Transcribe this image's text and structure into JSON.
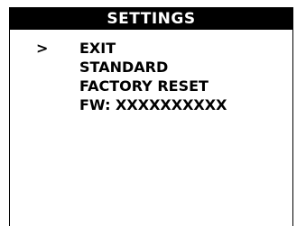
{
  "title": "SETTINGS",
  "cursor": ">",
  "menu": {
    "items": [
      {
        "label": "EXIT",
        "selected": true
      },
      {
        "label": "STANDARD",
        "selected": false
      },
      {
        "label": "FACTORY RESET",
        "selected": false
      },
      {
        "label": "FW: XXXXXXXXXX",
        "selected": false
      }
    ]
  }
}
